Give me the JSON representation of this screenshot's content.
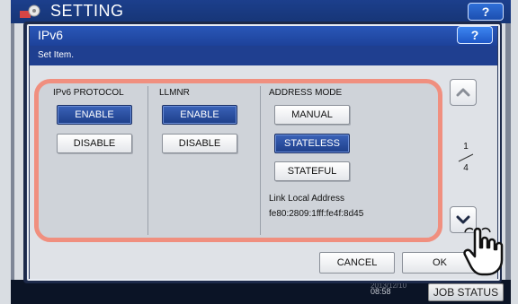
{
  "background": {
    "title": "SETTING",
    "help_label": "?",
    "time_top": "2013/12/10",
    "time": "08:58",
    "job_status_label": "JOB STATUS"
  },
  "dialog": {
    "title": "IPv6",
    "help_label": "?",
    "subtitle": "Set Item."
  },
  "columns": {
    "ipv6_protocol": {
      "label": "IPv6 PROTOCOL",
      "enable_label": "ENABLE",
      "disable_label": "DISABLE",
      "selected": "ENABLE"
    },
    "llmnr": {
      "label": "LLMNR",
      "enable_label": "ENABLE",
      "disable_label": "DISABLE",
      "selected": "ENABLE"
    },
    "address_mode": {
      "label": "ADDRESS MODE",
      "manual_label": "MANUAL",
      "stateless_label": "STATELESS",
      "stateful_label": "STATEFUL",
      "selected": "STATELESS",
      "link_local_label": "Link Local Address",
      "link_local_value": "fe80:2809:1fff:fe4f:8d45"
    }
  },
  "pager": {
    "current_page": "1",
    "total_pages": "4",
    "up_icon": "chevron-up-icon",
    "down_icon": "chevron-down-icon"
  },
  "actions": {
    "cancel_label": "CANCEL",
    "ok_label": "OK"
  },
  "colors": {
    "accent_blue": "#1e3f8a",
    "highlight_outline": "#f08f7f",
    "titlebar_blue": "#2a57b8"
  }
}
